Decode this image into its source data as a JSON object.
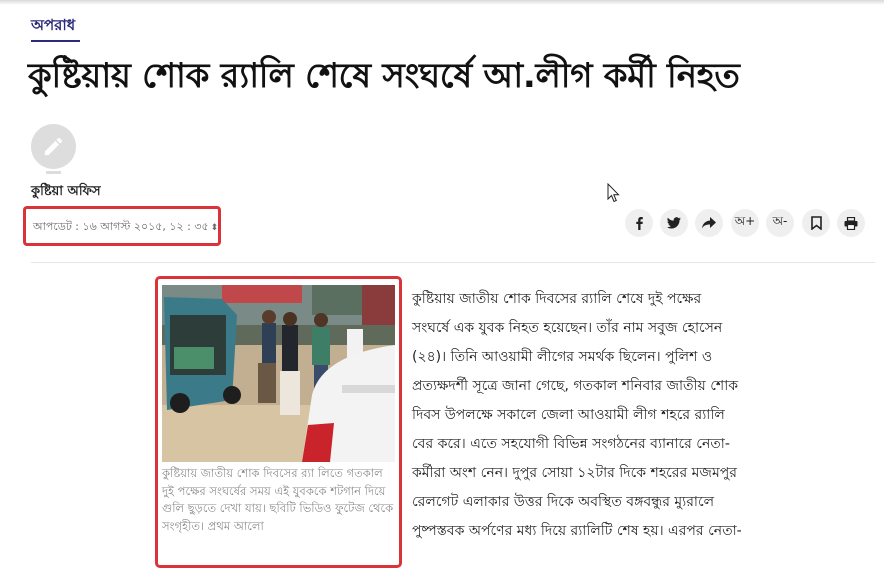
{
  "category": "অপরাধ",
  "headline": "কুষ্টিয়ায় শোক র‍্যালি শেষে সংঘর্ষে আ.লীগ কর্মী নিহত",
  "author": "কুষ্টিয়া অফিস",
  "updated": "আপডেট : ১৬ আগস্ট ২০১৫, ১২ : ৩৫",
  "share": {
    "font_increase": "অ+",
    "font_decrease": "অ-"
  },
  "figure": {
    "caption": "কুষ্টিয়ায় জাতীয় শোক দিবসের র‍্যা লিতে গতকাল দুই পক্ষের সংঘর্ষের সময় এই যুবককে শটগান দিয়ে গুলি ছুড়তে দেখা যায়। ছবিটি ভিডিও ফুটেজ থেকে সংগৃহীত। প্রথম আলো"
  },
  "article": {
    "body": "কুষ্টিয়ায় জাতীয় শোক দিবসের র‍্যালি শেষে দুই পক্ষের সংঘর্ষে এক যুবক নিহত হয়েছেন। তাঁর নাম সবুজ হোসেন (২৪)। তিনি আওয়ামী লীগের সমর্থক ছিলেন। পুলিশ ও প্রত্যক্ষদর্শী সূত্রে জানা গেছে, গতকাল শনিবার জাতীয় শোক দিবস উপলক্ষে সকালে জেলা আওয়ামী লীগ শহরে র‍্যালি বের করে। এতে সহযোগী বিভিন্ন সংগঠনের ব্যানারে নেতা-কর্মীরা অংশ নেন। দুপুর সোয়া ১২টার দিকে শহরের মজমপুর রেলগেট এলাকার উত্তর দিকে অবস্থিত বঙ্গবন্ধুর ম্যুরালে পুষ্পস্তবক অর্পণের মধ্য দিয়ে র‍্যালিটি শেষ হয়। এরপর নেতা-"
  },
  "colors": {
    "accent": "#2b2b7a",
    "highlight_border": "#d9343a",
    "caption_text": "#8a8a8a"
  },
  "icons": [
    "pencil-icon",
    "facebook-icon",
    "twitter-icon",
    "share-arrow-icon",
    "bookmark-icon",
    "print-icon",
    "mouse-cursor-icon"
  ]
}
